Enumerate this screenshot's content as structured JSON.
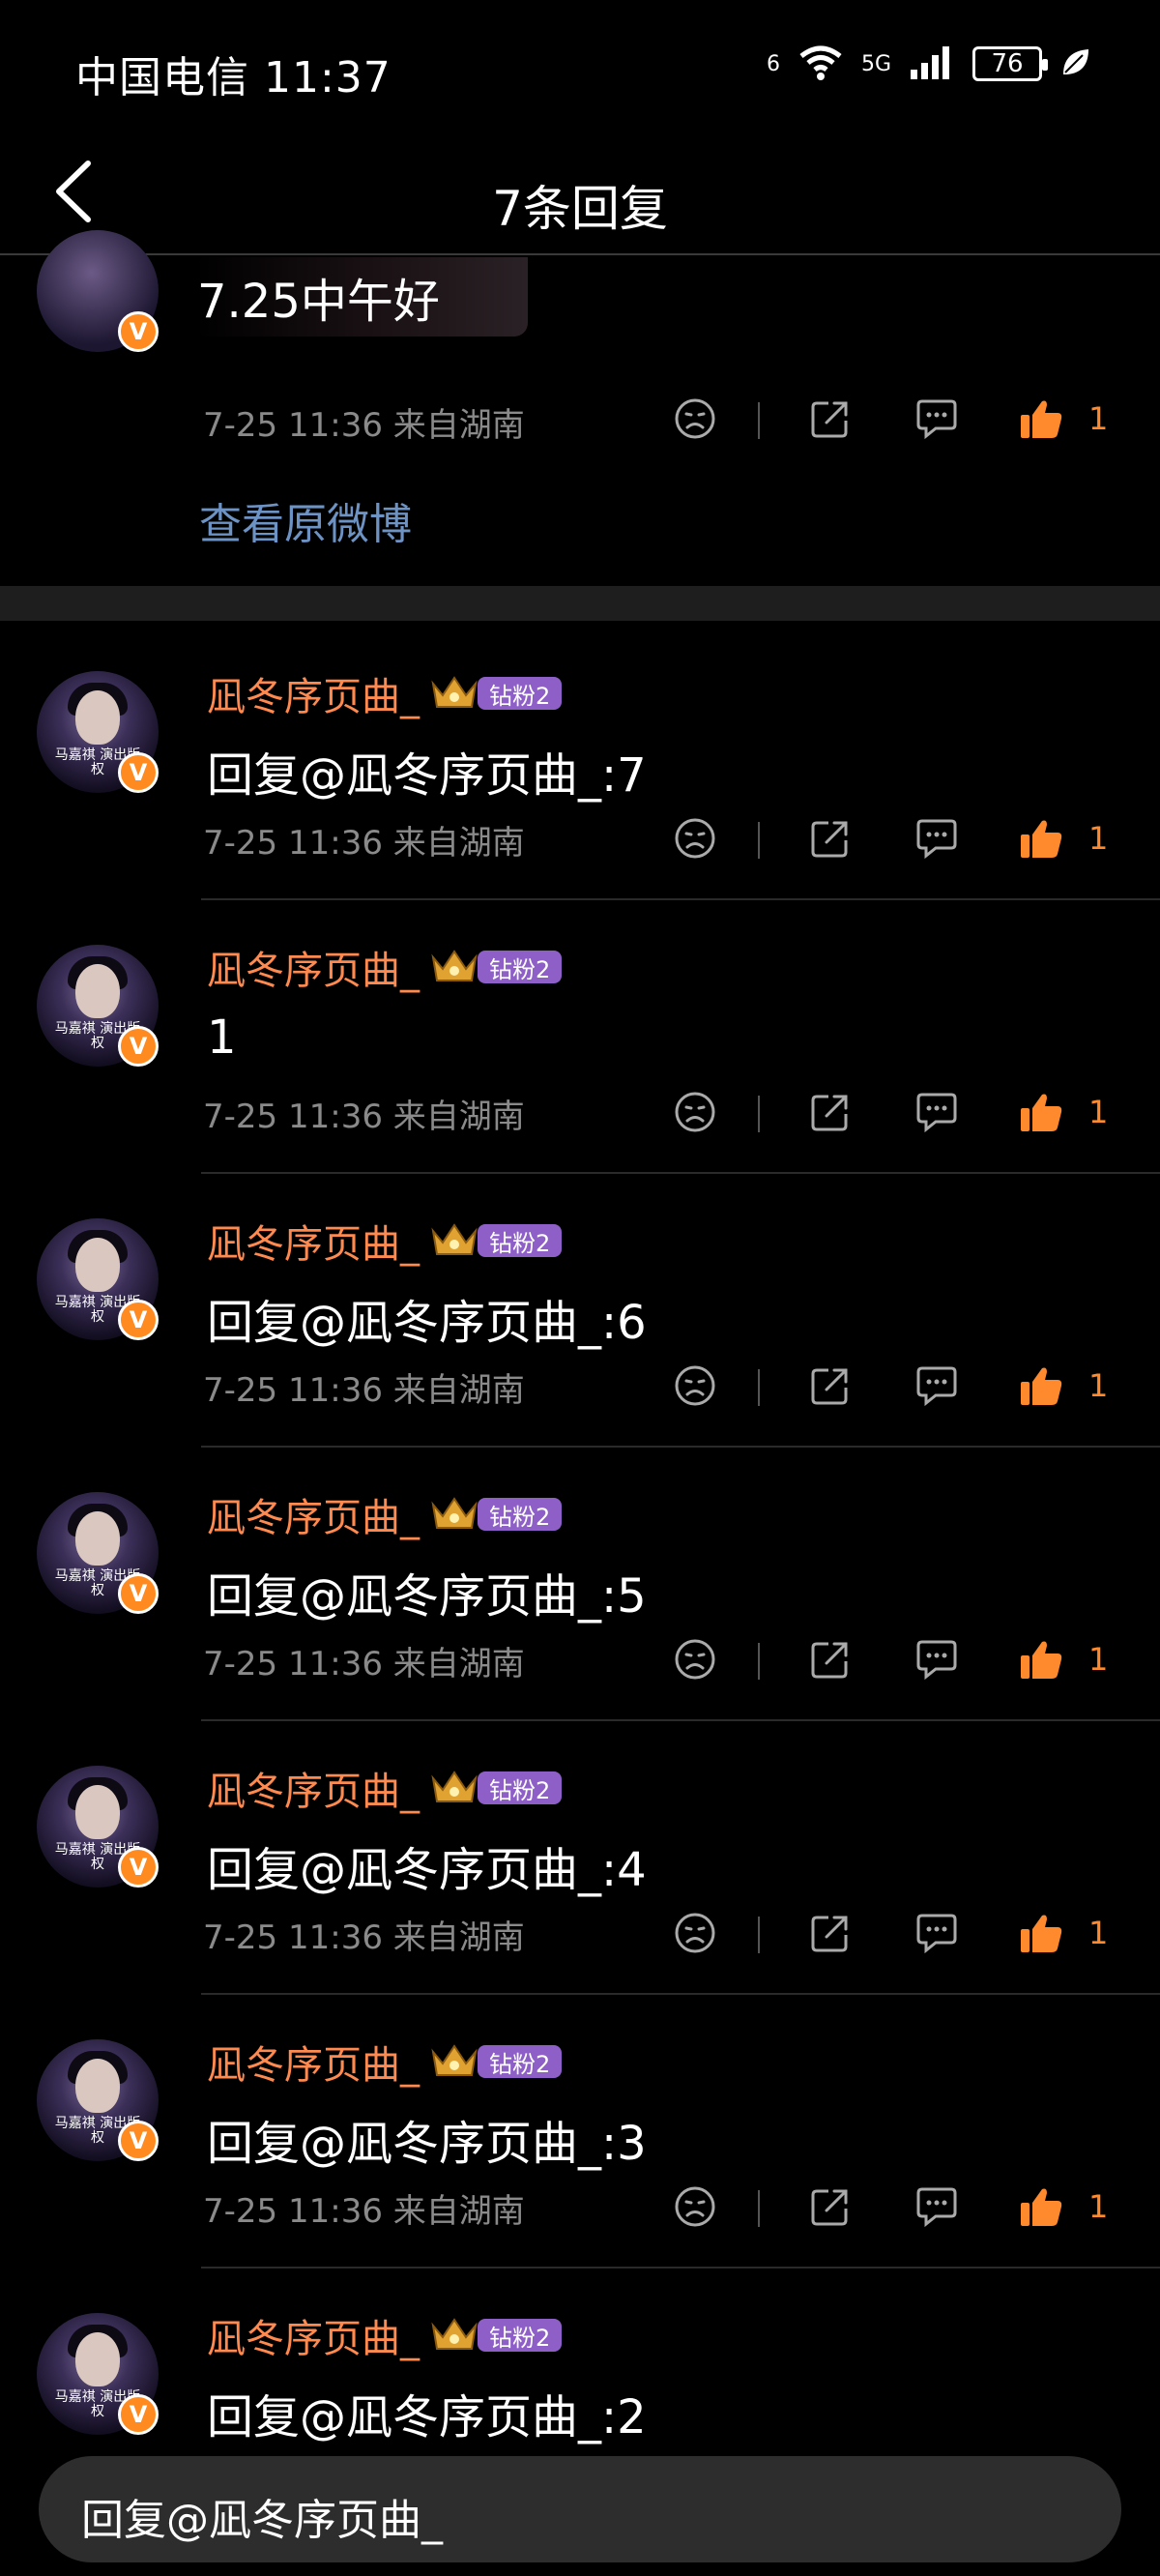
{
  "status_bar": {
    "carrier_time": "中国电信 11:37",
    "signal_label": "5G",
    "wifi_label": "6",
    "battery": "76"
  },
  "nav": {
    "title": "7条回复"
  },
  "original": {
    "text": "7.25中午好",
    "time": "7-25 11:36",
    "location": "来自湖南",
    "meta": "7-25 11:36  来自湖南",
    "like_count": "1",
    "view_original_label": "查看原微博"
  },
  "avatar_caption": "马嘉祺 演出版权",
  "verified_glyph": "V",
  "fan_badge": "钻粉2",
  "comments": [
    {
      "username": "凪冬序页曲_",
      "text": "回复@凪冬序页曲_:7",
      "meta": "7-25 11:36  来自湖南",
      "like_count": "1"
    },
    {
      "username": "凪冬序页曲_",
      "text": "1",
      "meta": "7-25 11:36  来自湖南",
      "like_count": "1"
    },
    {
      "username": "凪冬序页曲_",
      "text": "回复@凪冬序页曲_:6",
      "meta": "7-25 11:36  来自湖南",
      "like_count": "1"
    },
    {
      "username": "凪冬序页曲_",
      "text": "回复@凪冬序页曲_:5",
      "meta": "7-25 11:36  来自湖南",
      "like_count": "1"
    },
    {
      "username": "凪冬序页曲_",
      "text": "回复@凪冬序页曲_:4",
      "meta": "7-25 11:36  来自湖南",
      "like_count": "1"
    },
    {
      "username": "凪冬序页曲_",
      "text": "回复@凪冬序页曲_:3",
      "meta": "7-25 11:36  来自湖南",
      "like_count": "1"
    },
    {
      "username": "凪冬序页曲_",
      "text": "回复@凪冬序页曲_:2",
      "meta": "",
      "like_count": ""
    }
  ],
  "reply_bar": {
    "text": "回复@凪冬序页曲_"
  },
  "colors": {
    "background": "#000000",
    "username": "#ff8a4f",
    "like": "#ff8a2d",
    "link": "#6d92c4",
    "fan_badge": "#8d5fc7",
    "meta": "#8a8a8a"
  },
  "icons": [
    "back-arrow-icon",
    "wifi-icon",
    "signal-icon",
    "battery-icon",
    "leaf-icon",
    "sad-face-icon",
    "share-icon",
    "comment-icon",
    "thumbs-up-icon",
    "crown-icon",
    "verified-icon"
  ]
}
